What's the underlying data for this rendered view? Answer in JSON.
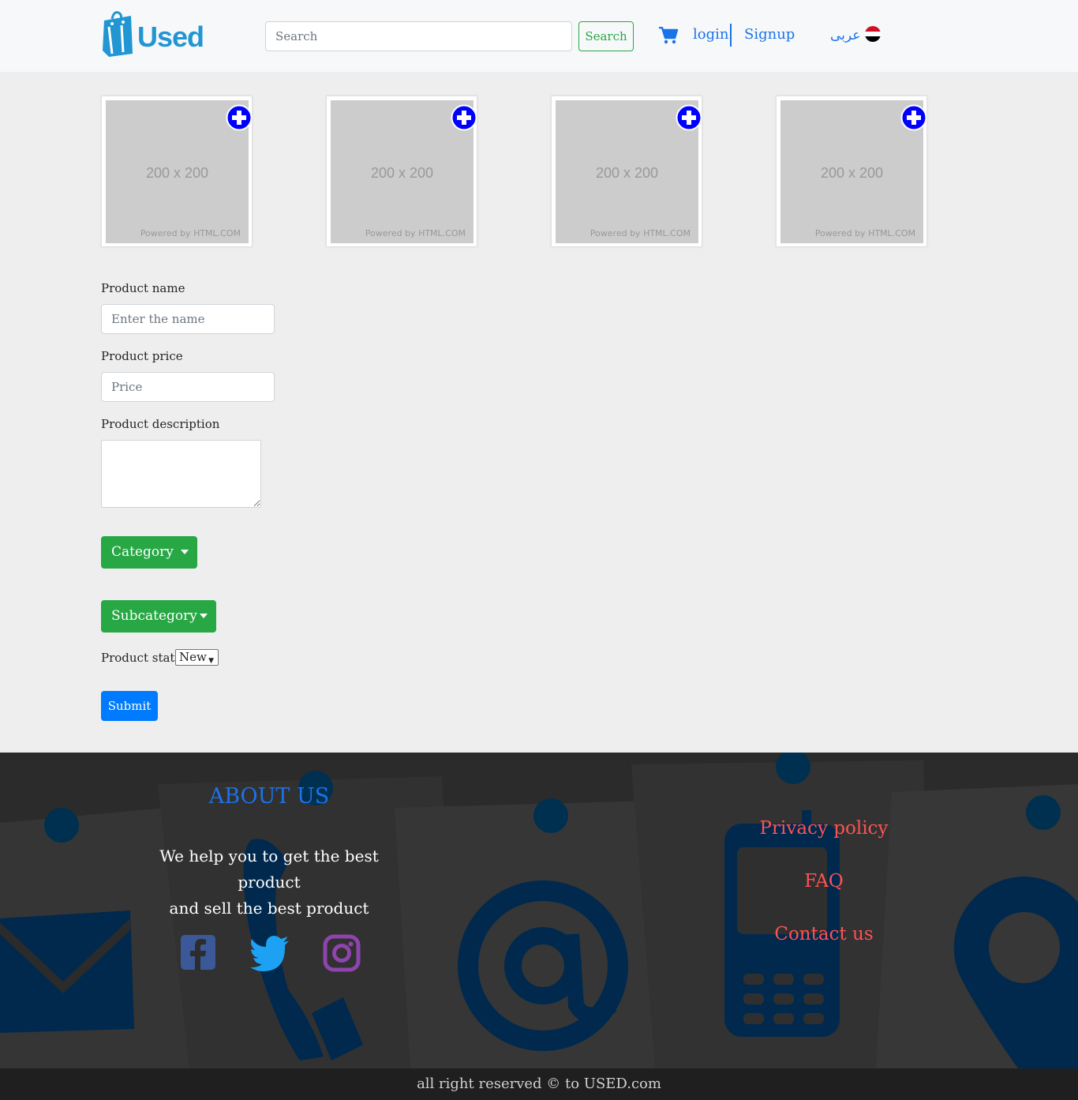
{
  "header": {
    "logo_text": "Used",
    "search_placeholder": "Search",
    "search_button": "Search",
    "login": "login",
    "signup": "Signup",
    "language": "عربى"
  },
  "images": {
    "placeholder_size": "200 x 200",
    "powered_by": "Powered by HTML.COM",
    "tiles": [
      {
        "size": "200 x 200",
        "powered": "Powered by HTML.COM"
      },
      {
        "size": "200 x 200",
        "powered": "Powered by HTML.COM"
      },
      {
        "size": "200 x 200",
        "powered": "Powered by HTML.COM"
      },
      {
        "size": "200 x 200",
        "powered": "Powered by HTML.COM"
      }
    ]
  },
  "form": {
    "name_label": "Product name",
    "name_placeholder": "Enter the name",
    "price_label": "Product price",
    "price_placeholder": "Price",
    "description_label": "Product description",
    "category_button": "Category",
    "subcategory_button": "Subcategory",
    "status_label": "Product status",
    "status_value": "New",
    "submit_button": "Submit"
  },
  "footer": {
    "about_title": "ABOUT US",
    "about_line1": "We help you to get the best product",
    "about_line2": "and sell the best product",
    "links": [
      "Privacy policy",
      "FAQ",
      "Contact us"
    ],
    "copyright": "all right reserved © to USED.com"
  },
  "icons": {
    "cart": "cart-icon",
    "flag": "egypt-flag-icon",
    "add": "plus-circle-icon",
    "social": [
      "facebook-icon",
      "twitter-icon",
      "instagram-icon"
    ]
  },
  "colors": {
    "brand": "#2196d3",
    "link": "#1a73e8",
    "success": "#28a745",
    "primary": "#007bff",
    "add_icon": "#0000ff",
    "footer_link": "#ff5252"
  }
}
